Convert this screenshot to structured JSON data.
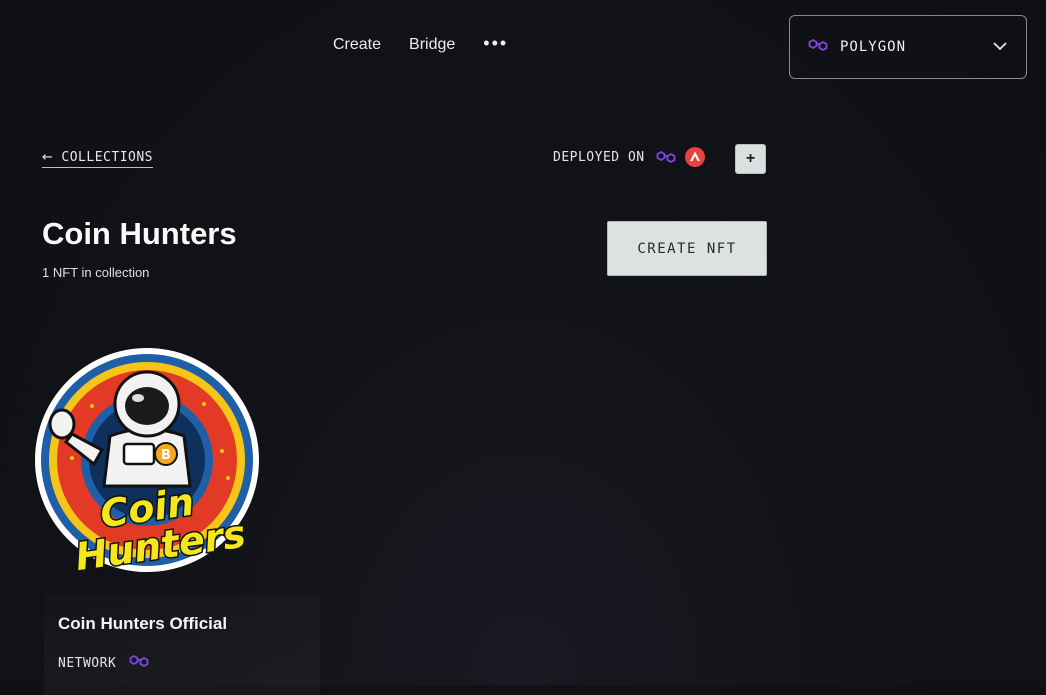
{
  "nav": {
    "links": [
      "Create",
      "Bridge"
    ],
    "more": "•••"
  },
  "network_select": {
    "value": "POLYGON",
    "icon": "polygon-icon"
  },
  "back_link": {
    "arrow": "←",
    "label": "COLLECTIONS"
  },
  "deployed": {
    "label": "DEPLOYED ON",
    "chains": [
      "polygon-icon",
      "avalanche-icon"
    ],
    "add_label": "+"
  },
  "collection": {
    "title": "Coin Hunters",
    "count_text": "1 NFT in collection"
  },
  "create_button": "CREATE NFT",
  "nft": {
    "name": "Coin Hunters Official",
    "network_label": "NETWORK",
    "network_icon": "polygon-icon",
    "image_text_line1": "Coin",
    "image_text_line2": "Hunters",
    "image_coin_symbol": "B"
  },
  "colors": {
    "polygon": "#8247e5",
    "avalanche": "#e84142",
    "button_bg": "#dbe2e1"
  }
}
